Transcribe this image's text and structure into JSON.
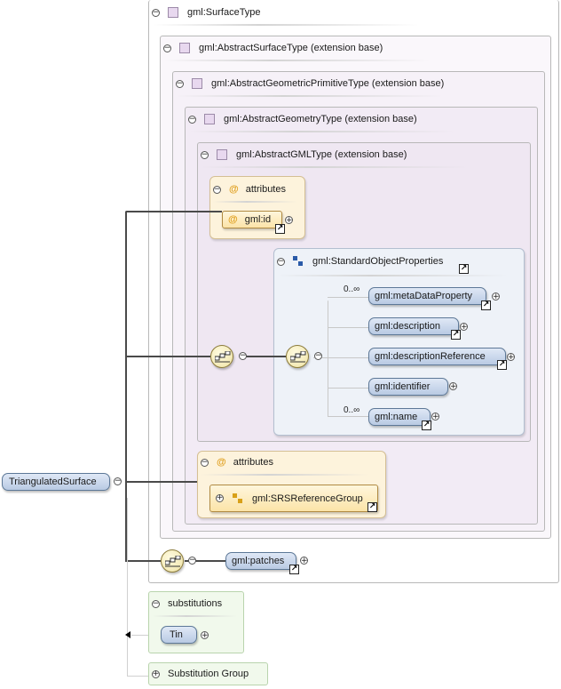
{
  "root": {
    "label": "TriangulatedSurface"
  },
  "complex_types": [
    {
      "label": "gml:SurfaceType"
    },
    {
      "label": "gml:AbstractSurfaceType (extension base)"
    },
    {
      "label": "gml:AbstractGeometricPrimitiveType (extension base)"
    },
    {
      "label": "gml:AbstractGeometryType (extension base)"
    },
    {
      "label": "gml:AbstractGMLType (extension base)"
    }
  ],
  "attributes_top": {
    "header": "attributes",
    "item": "gml:id"
  },
  "standard_object_properties": {
    "label": "gml:StandardObjectProperties",
    "elements": [
      {
        "label": "gml:metaDataProperty",
        "occurs": "0..∞"
      },
      {
        "label": "gml:description",
        "occurs": ""
      },
      {
        "label": "gml:descriptionReference",
        "occurs": ""
      },
      {
        "label": "gml:identifier",
        "occurs": ""
      },
      {
        "label": "gml:name",
        "occurs": "0..∞"
      }
    ]
  },
  "attributes_bottom": {
    "header": "attributes",
    "item": "gml:SRSReferenceGroup"
  },
  "patches": {
    "label": "gml:patches"
  },
  "substitutions": {
    "header": "substitutions",
    "item": "Tin"
  },
  "substitution_group": {
    "label": "Substitution Group"
  },
  "colors": {
    "element_fill": "#c9d6ec",
    "attribute_fill": "#fdefc8",
    "sequence_fill": "#f6eebc",
    "substitutions_fill": "#f1f9ec"
  }
}
